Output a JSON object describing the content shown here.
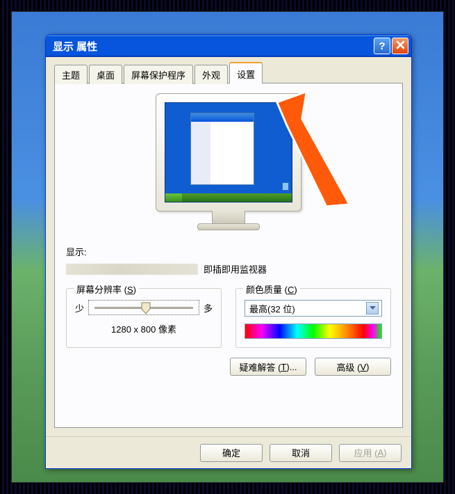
{
  "window": {
    "title": "显示 属性"
  },
  "tabs": [
    {
      "label": "主题"
    },
    {
      "label": "桌面"
    },
    {
      "label": "屏幕保护程序"
    },
    {
      "label": "外观"
    },
    {
      "label": "设置"
    }
  ],
  "display": {
    "label": "显示:",
    "monitor_name": "即插即用监视器"
  },
  "resolution": {
    "group_title": "屏幕分辨率 (",
    "group_accel": "S",
    "group_title_end": ")",
    "less": "少",
    "more": "多",
    "value": "1280 x 800 像素"
  },
  "color": {
    "group_title": "颜色质量 (",
    "group_accel": "C",
    "group_title_end": ")",
    "selected": "最高(32 位)"
  },
  "buttons": {
    "troubleshoot_prefix": "疑难解答 (",
    "troubleshoot_accel": "T",
    "troubleshoot_suffix": ")...",
    "advanced_prefix": "高级 (",
    "advanced_accel": "V",
    "advanced_suffix": ")",
    "ok": "确定",
    "cancel": "取消",
    "apply_prefix": "应用 (",
    "apply_accel": "A",
    "apply_suffix": ")"
  },
  "titlebar": {
    "help": "?"
  }
}
